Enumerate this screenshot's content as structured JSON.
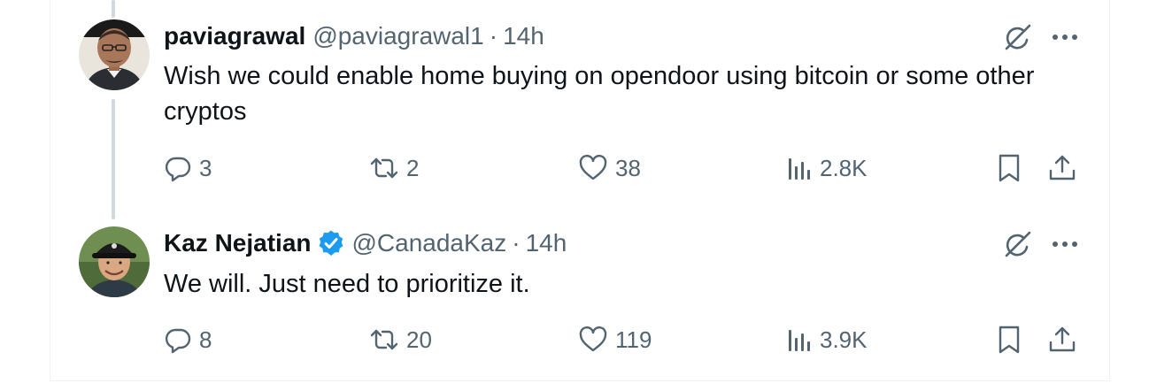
{
  "tweets": [
    {
      "display_name": "paviagrawal",
      "handle": "@paviagrawal1",
      "separator": "·",
      "time": "14h",
      "verified": false,
      "text": "Wish we could enable home buying on opendoor using  bitcoin or some other cryptos",
      "replies": "3",
      "retweets": "2",
      "likes": "38",
      "views": "2.8K"
    },
    {
      "display_name": "Kaz Nejatian",
      "handle": "@CanadaKaz",
      "separator": "·",
      "time": "14h",
      "verified": true,
      "text": "We will.  Just need to prioritize it.",
      "replies": "8",
      "retweets": "20",
      "likes": "119",
      "views": "3.9K"
    }
  ],
  "colors": {
    "text_primary": "#0f1419",
    "text_secondary": "#536471",
    "verified_blue": "#1d9bf0",
    "thread_line": "#cfd9de",
    "border": "#eff3f4"
  },
  "icons": [
    "grok-icon",
    "more-icon",
    "reply-icon",
    "retweet-icon",
    "like-icon",
    "views-icon",
    "bookmark-icon",
    "share-icon",
    "verified-badge-icon"
  ]
}
